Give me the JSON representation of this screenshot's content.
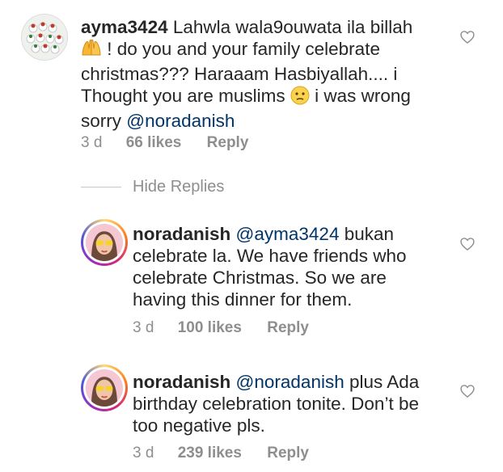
{
  "comments": [
    {
      "username": "ayma3424",
      "text_a": "Lahwla wala9ouwata ila billah",
      "emoji_a": "raised-hands-emoji",
      "text_b": "! do you and your family celebrate christmas??? Haraaam Hasbiyallah.... i Thought you are muslims",
      "emoji_b": "confused-face-emoji",
      "text_c": "i was wrong sorry",
      "mention": "@noradanish",
      "time": "3 d",
      "likes": "66 likes",
      "reply": "Reply"
    }
  ],
  "replies_toggle": "Hide Replies",
  "replies": [
    {
      "username": "noradanish",
      "mention": "@ayma3424",
      "text": "bukan celebrate la. We have friends who celebrate Christmas. So we are having this dinner for them.",
      "time": "3 d",
      "likes": "100 likes",
      "reply": "Reply"
    },
    {
      "username": "noradanish",
      "mention": "@noradanish",
      "text": "plus Ada birthday celebration tonite. Don’t be too negative pls.",
      "time": "3 d",
      "likes": "239 likes",
      "reply": "Reply"
    }
  ],
  "colors": {
    "text": "#262626",
    "meta": "#8e8e8e",
    "mention": "#003569"
  },
  "icons": [
    "heart-outline-icon"
  ]
}
